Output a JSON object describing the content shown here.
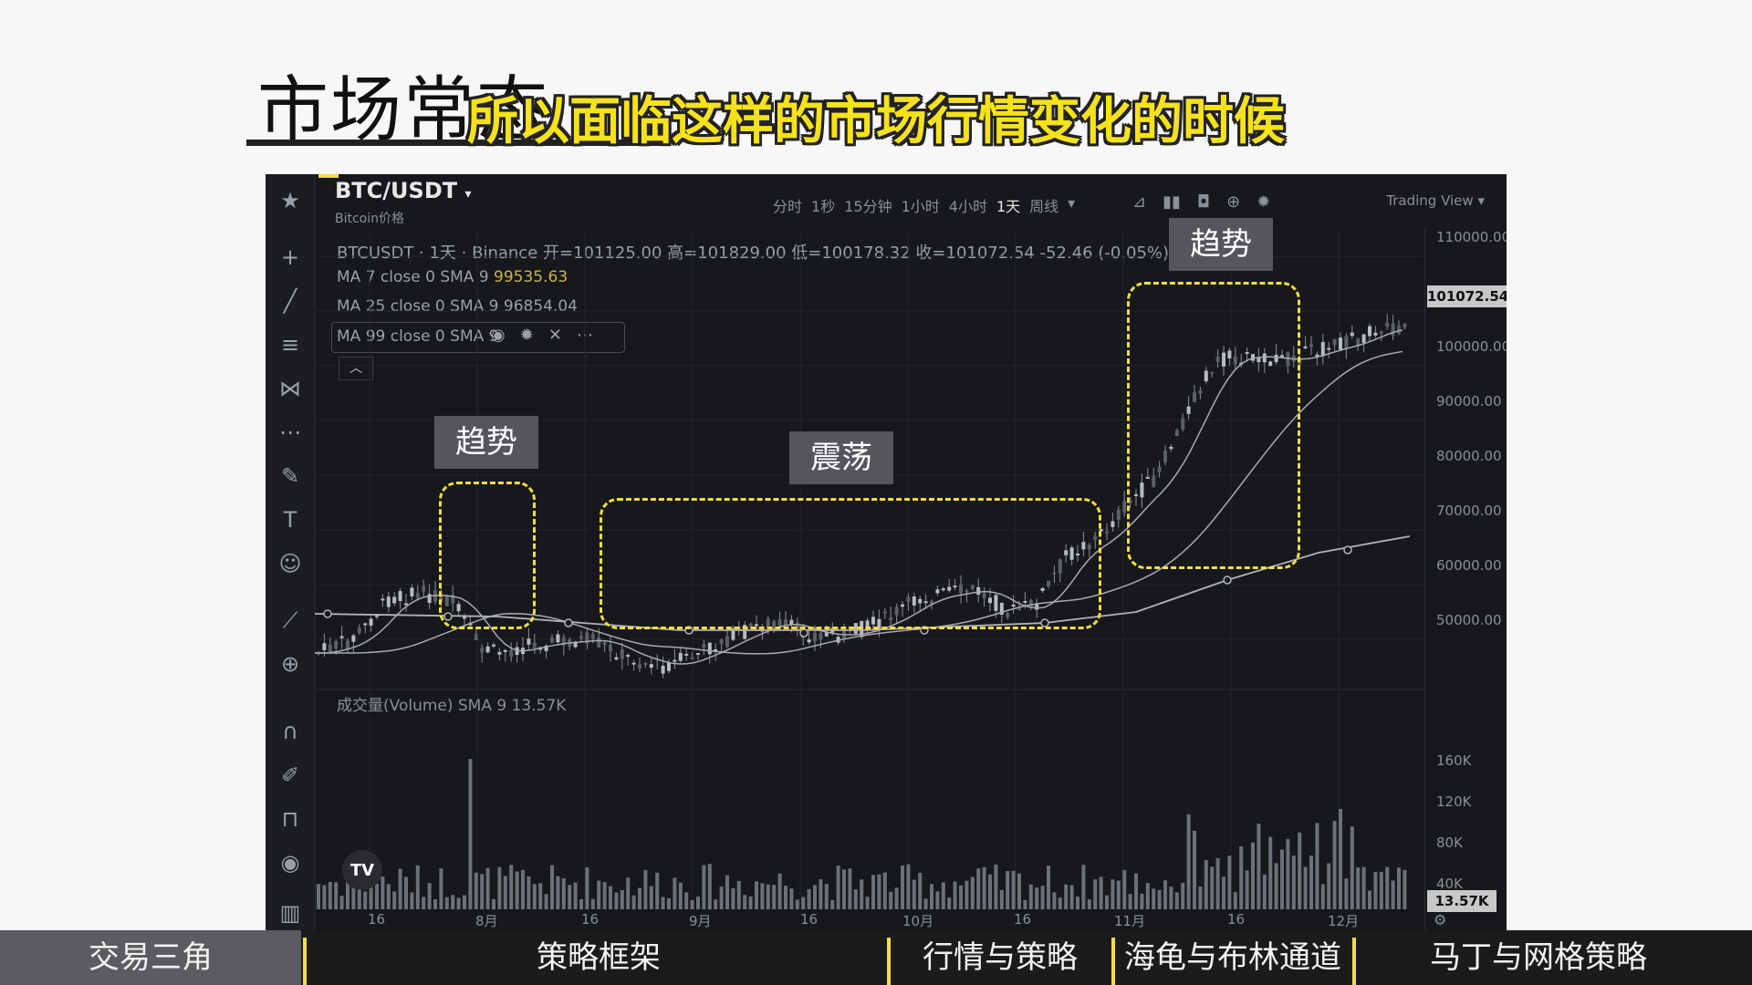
{
  "slide": {
    "title": "市场常态",
    "subtitle": "所以面临这样的市场行情变化的时候"
  },
  "chart": {
    "symbol": "BTC/USDT",
    "symbol_sub": "Bitcoin价格",
    "intervals": [
      "分时",
      "1秒",
      "15分钟",
      "1小时",
      "4小时",
      "1天",
      "周线"
    ],
    "active_interval": "1天",
    "view_label": "Trading View",
    "ohlc_line": "BTCUSDT · 1天 · Binance  开=101125.00 高=101829.00 低=100178.32 收=101072.54 -52.46 (-0.05%)",
    "ma7": {
      "label": "MA 7 close 0 SMA 9",
      "value": "99535.63"
    },
    "ma25": {
      "label": "MA 25 close 0 SMA 9",
      "value": "96854.04"
    },
    "ma99": {
      "label": "MA 99 close 0 SMA 9"
    },
    "current_price": "101072.54",
    "price_axis": [
      "110000.00",
      "100000.00",
      "90000.00",
      "80000.00",
      "70000.00",
      "60000.00",
      "50000.00"
    ],
    "volume_legend": "成交量(Volume) SMA 9  13.57K",
    "volume_axis": [
      "160K",
      "120K",
      "80K",
      "40K"
    ],
    "volume_current": "13.57K",
    "x_axis": [
      "16",
      "8月",
      "16",
      "9月",
      "16",
      "10月",
      "16",
      "11月",
      "16",
      "12月"
    ],
    "annotations": [
      {
        "label": "趋势"
      },
      {
        "label": "震荡"
      },
      {
        "label": "趋势"
      }
    ]
  },
  "nav": {
    "items": [
      "交易三角",
      "策略框架",
      "行情与策略",
      "海龟与布林通道",
      "马丁与网格策略"
    ]
  },
  "colors": {
    "accent": "#f3df3b",
    "chart_bg": "#17181c",
    "candles": "#8c8f96"
  },
  "icons": [
    "star-icon",
    "crosshair-icon",
    "trendline-icon",
    "fib-icon",
    "pattern-icon",
    "measure-icon",
    "brush-icon",
    "text-icon",
    "emoji-icon",
    "ruler-icon",
    "zoom-icon",
    "magnet-icon",
    "lock-draw-icon",
    "lock-icon",
    "eye-icon",
    "trash-icon"
  ]
}
